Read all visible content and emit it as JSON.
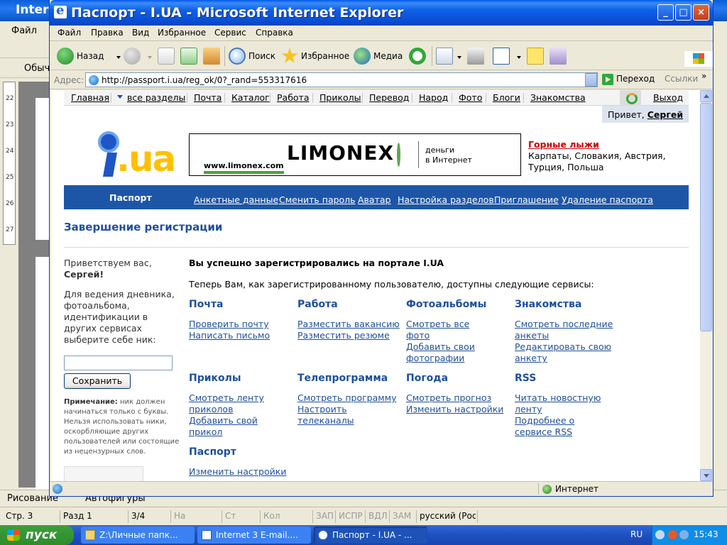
{
  "word": {
    "title": "Inter",
    "menu_file": "Файл",
    "style_box": "Обыч",
    "ruler_numbers": [
      "22",
      "23",
      "24",
      "25",
      "26",
      "27"
    ],
    "draw_label": "Рисование",
    "autoshapes_label": "Автофигуры",
    "status": {
      "page": "Стр. 3",
      "section": "Разд 1",
      "pages": "3/4",
      "at": "На",
      "line": "Ст",
      "col": "Кол",
      "rec": "ЗАП",
      "trk": "ИСПР",
      "ext": "ВДЛ",
      "ovr": "ЗАМ",
      "lang": "русский (Рос"
    }
  },
  "taskbar": {
    "start_label": "пуск",
    "items": [
      {
        "label": "Z:\\Личные папк..."
      },
      {
        "label": "Internet 3 E-mail...."
      },
      {
        "label": "Паспорт - I.UA  - ..."
      }
    ],
    "lang": "RU",
    "clock": "15:43"
  },
  "ie": {
    "title": "Паспорт - I.UA  - Microsoft Internet Explorer",
    "min": "_",
    "max": "□",
    "close": "×",
    "menu": [
      "Файл",
      "Правка",
      "Вид",
      "Избранное",
      "Сервис",
      "Справка"
    ],
    "toolbar": {
      "back": "Назад",
      "search": "Поиск",
      "favorites": "Избранное",
      "media": "Медиа"
    },
    "address_label": "Адрес:",
    "address": "http://passport.i.ua/reg_ok/0?_rand=553317616",
    "go": "Переход",
    "links": "Ссылки",
    "links_more": "»",
    "status_zone": "Интернет"
  },
  "site": {
    "nav": [
      "Главная",
      "все разделы",
      "Почта",
      "Каталог",
      "Работа",
      "Приколы",
      "Перевод",
      "Народ",
      "Фото",
      "Блоги",
      "Знакомства"
    ],
    "logout": "Выход",
    "greet_prefix": "Привет, ",
    "greet_name": "Сергей",
    "logo_text": ".ua",
    "banner": {
      "brand": "LIMONEX",
      "url": "www.limonex.com",
      "tag1": "деньги",
      "tag2": "в Интернет"
    },
    "promo_title": "Горные лыжи",
    "promo_text": "Карпаты, Словакия, Австрия, Турция, Польша",
    "section": {
      "name": "Паспорт",
      "links": [
        "Анкетные данные",
        "Сменить пароль",
        "Аватар",
        "Настройка разделов",
        "Приглашение",
        "Удаление паспорта"
      ]
    },
    "page_title": "Завершение регистрации",
    "left": {
      "welcome": "Приветствуем вас,",
      "name": "Сергей!",
      "desc": "Для ведения дневника, фотоальбома, идентификации в других сервисах выберите себе ник:",
      "input_value": "",
      "save": "Сохранить",
      "note_label": "Примечание:",
      "note_text": " ник должен начинаться только с буквы. Нельзя использовать ники, оскорбляющие других пользователей или состоящие из нецензурных слов."
    },
    "success_title": "Вы успешно зарегистрировались на портале I.UA",
    "success_sub": "Теперь Вам, как зарегистрированному пользователю, доступны следующие сервисы:",
    "services": [
      {
        "title": "Почта",
        "links": [
          "Проверить почту",
          "Написать письмо"
        ]
      },
      {
        "title": "Работа",
        "links": [
          "Разместить вакансию",
          "Разместить резюме"
        ]
      },
      {
        "title": "Фотоальбомы",
        "links": [
          "Смотреть все фото",
          "Добавить свои фотографии"
        ]
      },
      {
        "title": "Знакомства",
        "links": [
          "Смотреть последние анкеты",
          "Редактировать свою анкету"
        ]
      },
      {
        "title": "Приколы",
        "links": [
          "Смотреть ленту приколов",
          "Добавить свой прикол"
        ]
      },
      {
        "title": "Телепрограмма",
        "links": [
          "Смотреть программу",
          "Настроить телеканалы"
        ]
      },
      {
        "title": "Погода",
        "links": [
          "Смотреть прогноз",
          "Изменить настройки"
        ]
      },
      {
        "title": "RSS",
        "links": [
          "Читать новостную ленту",
          "Подробнее о сервисе RSS"
        ]
      },
      {
        "title": "Паспорт",
        "links": [
          "Изменить настройки"
        ]
      }
    ]
  }
}
